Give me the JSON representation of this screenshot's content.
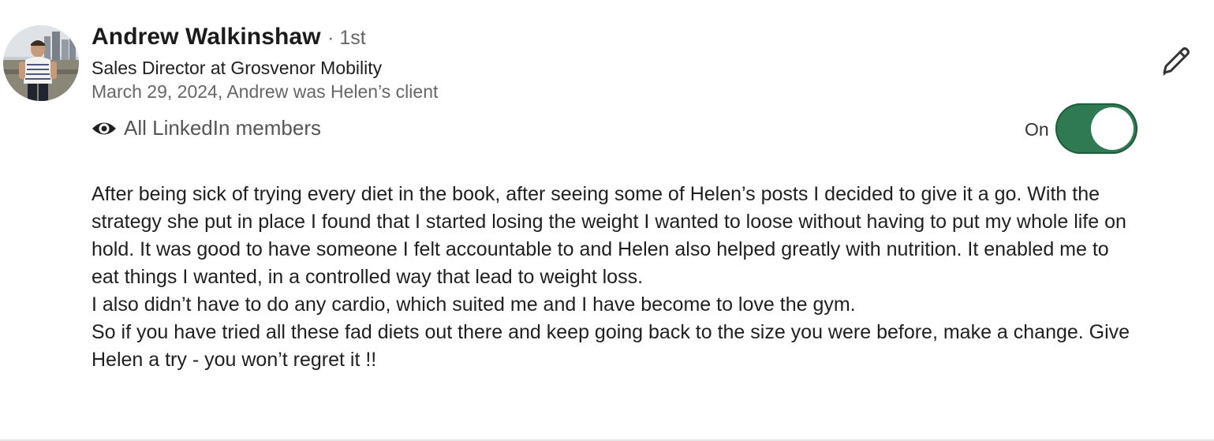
{
  "recommendation": {
    "author_name": "Andrew Walkinshaw",
    "degree": "· 1st",
    "headline": "Sales Director at Grosvenor Mobility",
    "meta": "March 29, 2024, Andrew was Helen’s client",
    "visibility_label": "All LinkedIn members",
    "visibility_icon": "eye-icon",
    "edit_icon": "pencil-icon",
    "toggle_label": "On",
    "toggle_on": true,
    "toggle_color": "#2f7a52",
    "paragraphs": [
      "After being sick of trying every diet in the book, after seeing some of Helen’s posts I decided to give it a go. With the strategy she put in place I found that I started losing the weight I wanted to loose without having to put my whole life on hold. It was good to have someone I felt accountable to and Helen also helped greatly with nutrition. It enabled me to eat things I wanted, in a controlled way that lead to weight loss.",
      "I also didn’t have to do any cardio, which suited me and I have become to love the gym.",
      "So if you have tried all these fad diets out there and keep going back to the size you were before, make a change. Give Helen a try - you won’t regret it !!"
    ]
  }
}
